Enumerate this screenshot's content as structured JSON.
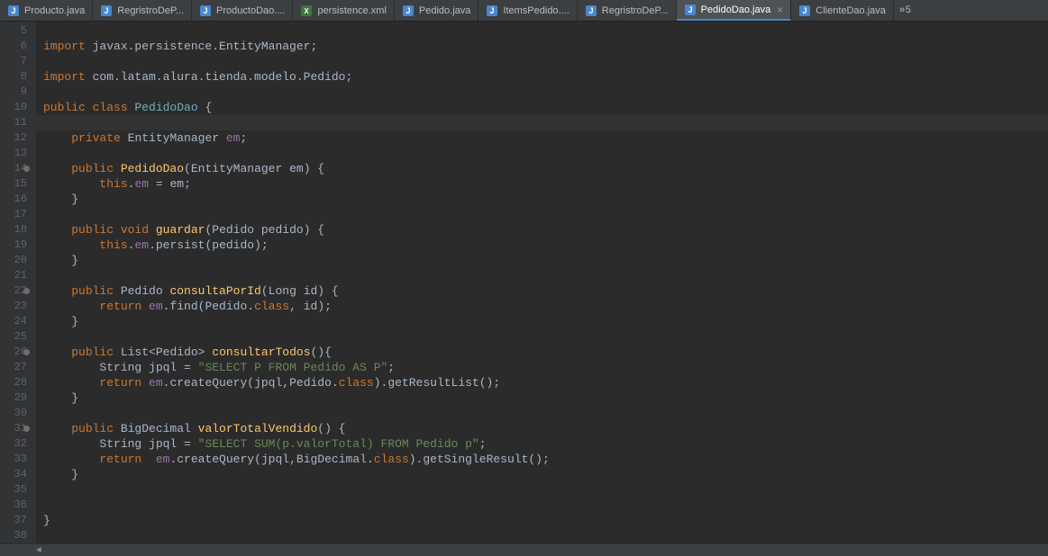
{
  "tabs": [
    {
      "label": "Producto.java",
      "icon": "java"
    },
    {
      "label": "RegristroDeP...",
      "icon": "java"
    },
    {
      "label": "ProductoDao....",
      "icon": "java"
    },
    {
      "label": "persistence.xml",
      "icon": "xml"
    },
    {
      "label": "Pedido.java",
      "icon": "java"
    },
    {
      "label": "ItemsPedido....",
      "icon": "java"
    },
    {
      "label": "RegristroDeP...",
      "icon": "java"
    },
    {
      "label": "PedidoDao.java",
      "icon": "java",
      "active": true,
      "closeable": true
    },
    {
      "label": "ClienteDao.java",
      "icon": "java"
    }
  ],
  "more_tabs_label": "»5",
  "line_start": 5,
  "line_end": 38,
  "markers": [
    14,
    22,
    26,
    31
  ],
  "highlight_line": 11,
  "code_lines": [
    {
      "n": 5,
      "tokens": [
        {
          "t": "",
          "c": ""
        }
      ]
    },
    {
      "n": 6,
      "tokens": [
        {
          "t": "import ",
          "c": "kw"
        },
        {
          "t": "javax.persistence.EntityManager;",
          "c": "qual"
        }
      ]
    },
    {
      "n": 7,
      "tokens": []
    },
    {
      "n": 8,
      "tokens": [
        {
          "t": "import ",
          "c": "kw"
        },
        {
          "t": "com.latam.alura.tienda.modelo.Pedido;",
          "c": "qual"
        }
      ]
    },
    {
      "n": 9,
      "tokens": []
    },
    {
      "n": 10,
      "tokens": [
        {
          "t": "public class ",
          "c": "kw"
        },
        {
          "t": "PedidoDao",
          "c": "cls"
        },
        {
          "t": " {",
          "c": "punct"
        }
      ]
    },
    {
      "n": 11,
      "tokens": []
    },
    {
      "n": 12,
      "tokens": [
        {
          "t": "    ",
          "c": ""
        },
        {
          "t": "private ",
          "c": "kw"
        },
        {
          "t": "EntityManager ",
          "c": "type"
        },
        {
          "t": "em",
          "c": "field"
        },
        {
          "t": ";",
          "c": "punct"
        }
      ]
    },
    {
      "n": 13,
      "tokens": []
    },
    {
      "n": 14,
      "tokens": [
        {
          "t": "    ",
          "c": ""
        },
        {
          "t": "public ",
          "c": "kw"
        },
        {
          "t": "PedidoDao",
          "c": "method"
        },
        {
          "t": "(",
          "c": "punct"
        },
        {
          "t": "EntityManager ",
          "c": "type"
        },
        {
          "t": "em",
          "c": "param"
        },
        {
          "t": ") {",
          "c": "punct"
        }
      ]
    },
    {
      "n": 15,
      "tokens": [
        {
          "t": "        ",
          "c": ""
        },
        {
          "t": "this",
          "c": "kw"
        },
        {
          "t": ".",
          "c": "punct"
        },
        {
          "t": "em",
          "c": "field"
        },
        {
          "t": " = ",
          "c": "punct"
        },
        {
          "t": "em",
          "c": "param"
        },
        {
          "t": ";",
          "c": "punct"
        }
      ]
    },
    {
      "n": 16,
      "tokens": [
        {
          "t": "    }",
          "c": "punct"
        }
      ]
    },
    {
      "n": 17,
      "tokens": []
    },
    {
      "n": 18,
      "tokens": [
        {
          "t": "    ",
          "c": ""
        },
        {
          "t": "public void ",
          "c": "kw"
        },
        {
          "t": "guardar",
          "c": "method"
        },
        {
          "t": "(",
          "c": "punct"
        },
        {
          "t": "Pedido ",
          "c": "type"
        },
        {
          "t": "pedido",
          "c": "param"
        },
        {
          "t": ") {",
          "c": "punct"
        }
      ]
    },
    {
      "n": 19,
      "tokens": [
        {
          "t": "        ",
          "c": ""
        },
        {
          "t": "this",
          "c": "kw"
        },
        {
          "t": ".",
          "c": "punct"
        },
        {
          "t": "em",
          "c": "field"
        },
        {
          "t": ".persist(",
          "c": "punct"
        },
        {
          "t": "pedido",
          "c": "param"
        },
        {
          "t": ");",
          "c": "punct"
        }
      ]
    },
    {
      "n": 20,
      "tokens": [
        {
          "t": "    }",
          "c": "punct"
        }
      ]
    },
    {
      "n": 21,
      "tokens": []
    },
    {
      "n": 22,
      "tokens": [
        {
          "t": "    ",
          "c": ""
        },
        {
          "t": "public ",
          "c": "kw"
        },
        {
          "t": "Pedido ",
          "c": "type"
        },
        {
          "t": "consultaPorId",
          "c": "method"
        },
        {
          "t": "(",
          "c": "punct"
        },
        {
          "t": "Long ",
          "c": "type"
        },
        {
          "t": "id",
          "c": "param"
        },
        {
          "t": ") {",
          "c": "punct"
        }
      ]
    },
    {
      "n": 23,
      "tokens": [
        {
          "t": "        ",
          "c": ""
        },
        {
          "t": "return ",
          "c": "kw"
        },
        {
          "t": "em",
          "c": "field"
        },
        {
          "t": ".find(",
          "c": "punct"
        },
        {
          "t": "Pedido",
          "c": "type"
        },
        {
          "t": ".",
          "c": "punct"
        },
        {
          "t": "class",
          "c": "kw"
        },
        {
          "t": ", ",
          "c": "punct"
        },
        {
          "t": "id",
          "c": "param"
        },
        {
          "t": ");",
          "c": "punct"
        }
      ]
    },
    {
      "n": 24,
      "tokens": [
        {
          "t": "    }",
          "c": "punct"
        }
      ]
    },
    {
      "n": 25,
      "tokens": []
    },
    {
      "n": 26,
      "tokens": [
        {
          "t": "    ",
          "c": ""
        },
        {
          "t": "public ",
          "c": "kw"
        },
        {
          "t": "List",
          "c": "type"
        },
        {
          "t": "<",
          "c": "punct"
        },
        {
          "t": "Pedido",
          "c": "type"
        },
        {
          "t": "> ",
          "c": "punct"
        },
        {
          "t": "consultarTodos",
          "c": "method"
        },
        {
          "t": "(){",
          "c": "punct"
        }
      ]
    },
    {
      "n": 27,
      "tokens": [
        {
          "t": "        ",
          "c": ""
        },
        {
          "t": "String ",
          "c": "type"
        },
        {
          "t": "jpql",
          "c": "param"
        },
        {
          "t": " = ",
          "c": "punct"
        },
        {
          "t": "\"SELECT P FROM Pedido AS P\"",
          "c": "str"
        },
        {
          "t": ";",
          "c": "punct"
        }
      ]
    },
    {
      "n": 28,
      "tokens": [
        {
          "t": "        ",
          "c": ""
        },
        {
          "t": "return ",
          "c": "kw"
        },
        {
          "t": "em",
          "c": "field"
        },
        {
          "t": ".createQuery(",
          "c": "punct"
        },
        {
          "t": "jpql",
          "c": "param"
        },
        {
          "t": ",",
          "c": "punct"
        },
        {
          "t": "Pedido",
          "c": "type"
        },
        {
          "t": ".",
          "c": "punct"
        },
        {
          "t": "class",
          "c": "kw"
        },
        {
          "t": ").getResultList();",
          "c": "punct"
        }
      ]
    },
    {
      "n": 29,
      "tokens": [
        {
          "t": "    }",
          "c": "punct"
        }
      ]
    },
    {
      "n": 30,
      "tokens": []
    },
    {
      "n": 31,
      "tokens": [
        {
          "t": "    ",
          "c": ""
        },
        {
          "t": "public ",
          "c": "kw"
        },
        {
          "t": "BigDecimal ",
          "c": "type"
        },
        {
          "t": "valorTotalVendido",
          "c": "method"
        },
        {
          "t": "() {",
          "c": "punct"
        }
      ]
    },
    {
      "n": 32,
      "tokens": [
        {
          "t": "        ",
          "c": ""
        },
        {
          "t": "String ",
          "c": "type"
        },
        {
          "t": "jpql",
          "c": "param"
        },
        {
          "t": " = ",
          "c": "punct"
        },
        {
          "t": "\"SELECT SUM(p.valorTotal) FROM Pedido p\"",
          "c": "str"
        },
        {
          "t": ";",
          "c": "punct"
        }
      ]
    },
    {
      "n": 33,
      "tokens": [
        {
          "t": "        ",
          "c": ""
        },
        {
          "t": "return  ",
          "c": "kw"
        },
        {
          "t": "em",
          "c": "field"
        },
        {
          "t": ".createQuery(",
          "c": "punct"
        },
        {
          "t": "jpql",
          "c": "param"
        },
        {
          "t": ",",
          "c": "punct"
        },
        {
          "t": "BigDecimal",
          "c": "type"
        },
        {
          "t": ".",
          "c": "punct"
        },
        {
          "t": "class",
          "c": "kw"
        },
        {
          "t": ").getSingleResult();",
          "c": "punct"
        }
      ]
    },
    {
      "n": 34,
      "tokens": [
        {
          "t": "    }",
          "c": "punct"
        }
      ]
    },
    {
      "n": 35,
      "tokens": []
    },
    {
      "n": 36,
      "tokens": []
    },
    {
      "n": 37,
      "tokens": [
        {
          "t": "}",
          "c": "punct"
        }
      ]
    },
    {
      "n": 38,
      "tokens": []
    }
  ]
}
